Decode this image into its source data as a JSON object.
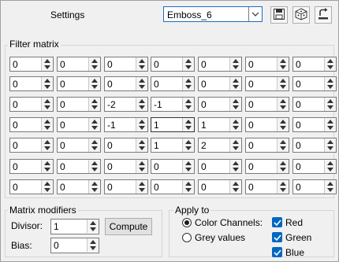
{
  "header": {
    "title": "Settings",
    "preset_value": "Emboss_6"
  },
  "filter_matrix": {
    "label": "Filter matrix",
    "rows": [
      [
        "0",
        "0",
        "0",
        "0",
        "0",
        "0",
        "0"
      ],
      [
        "0",
        "0",
        "0",
        "0",
        "0",
        "0",
        "0"
      ],
      [
        "0",
        "0",
        "-2",
        "-1",
        "0",
        "0",
        "0"
      ],
      [
        "0",
        "0",
        "-1",
        "1",
        "1",
        "0",
        "0"
      ],
      [
        "0",
        "0",
        "0",
        "1",
        "2",
        "0",
        "0"
      ],
      [
        "0",
        "0",
        "0",
        "0",
        "0",
        "0",
        "0"
      ],
      [
        "0",
        "0",
        "0",
        "0",
        "0",
        "0",
        "0"
      ]
    ]
  },
  "modifiers": {
    "label": "Matrix modifiers",
    "divisor_label": "Divisor:",
    "divisor_value": "1",
    "bias_label": "Bias:",
    "bias_value": "0",
    "compute_label": "Compute"
  },
  "apply_to": {
    "label": "Apply to",
    "color_channels_label": "Color Channels:",
    "grey_values_label": "Grey values",
    "red_label": "Red",
    "green_label": "Green",
    "blue_label": "Blue"
  }
}
